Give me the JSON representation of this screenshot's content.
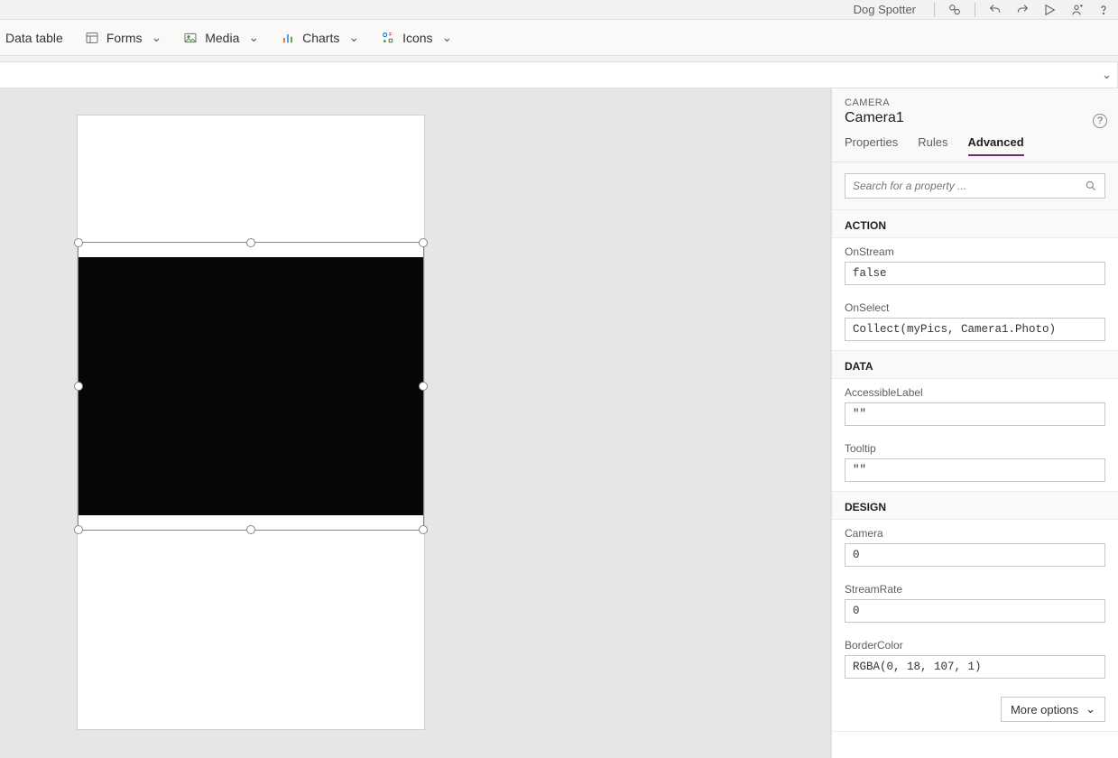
{
  "topbar": {
    "app_name": "Dog Spotter"
  },
  "ribbon": {
    "data_table": "Data table",
    "forms": "Forms",
    "media": "Media",
    "charts": "Charts",
    "icons": "Icons"
  },
  "properties_pane": {
    "type_label": "CAMERA",
    "control_name": "Camera1",
    "tabs": {
      "properties": "Properties",
      "rules": "Rules",
      "advanced": "Advanced"
    },
    "search_placeholder": "Search for a property ...",
    "sections": {
      "action": {
        "title": "ACTION",
        "props": {
          "OnStream": {
            "label": "OnStream",
            "value": "false"
          },
          "OnSelect": {
            "label": "OnSelect",
            "value": "Collect(myPics, Camera1.Photo)"
          }
        }
      },
      "data": {
        "title": "DATA",
        "props": {
          "AccessibleLabel": {
            "label": "AccessibleLabel",
            "value": "\"\""
          },
          "Tooltip": {
            "label": "Tooltip",
            "value": "\"\""
          }
        }
      },
      "design": {
        "title": "DESIGN",
        "props": {
          "Camera": {
            "label": "Camera",
            "value": "0"
          },
          "StreamRate": {
            "label": "StreamRate",
            "value": "0"
          },
          "BorderColor": {
            "label": "BorderColor",
            "value": "RGBA(0, 18, 107, 1)"
          }
        }
      }
    },
    "more_options": "More options"
  }
}
